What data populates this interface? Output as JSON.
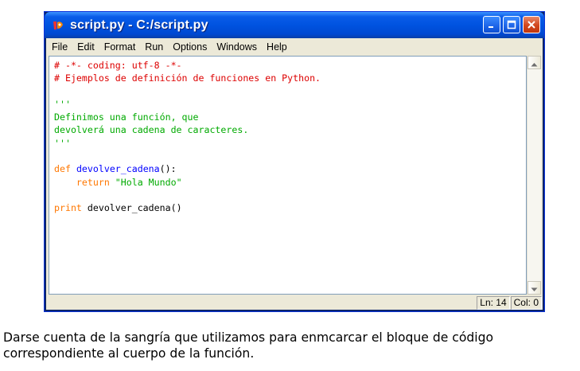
{
  "window": {
    "title": "script.py - C:/script.py",
    "icon": "python-idle-icon"
  },
  "title_buttons": [
    "minimize-icon",
    "maximize-icon",
    "close-icon"
  ],
  "menu": [
    {
      "label": "File"
    },
    {
      "label": "Edit"
    },
    {
      "label": "Format"
    },
    {
      "label": "Run"
    },
    {
      "label": "Options"
    },
    {
      "label": "Windows"
    },
    {
      "label": "Help"
    }
  ],
  "code": {
    "line1": "# -*- coding: utf-8 -*-",
    "line2": "# Ejemplos de definición de funciones en Python.",
    "line3": "",
    "line4": "'''",
    "line5": "Definimos una función, que",
    "line6": "devolverá una cadena de caracteres.",
    "line7": "'''",
    "line8": "",
    "line9_kw": "def",
    "line9_name": "devolver_cadena",
    "line9_rest": "():",
    "line10_indent": "    ",
    "line10_kw": "return",
    "line10_str": "\"Hola Mundo\"",
    "line11": "",
    "line12_kw": "print",
    "line12_rest": " devolver_cadena()"
  },
  "status": {
    "line": "Ln: 14",
    "col": "Col: 0"
  },
  "caption": {
    "line1": "Darse cuenta de la sangría que utilizamos para enmcarcar el bloque de código",
    "line2": "correspondiente al cuerpo de la función."
  },
  "colors": {
    "comment": "#dd0000",
    "string": "#00aa00",
    "keyword": "#ff7700",
    "definition": "#0000ff",
    "titlebar": "#0053e0"
  }
}
